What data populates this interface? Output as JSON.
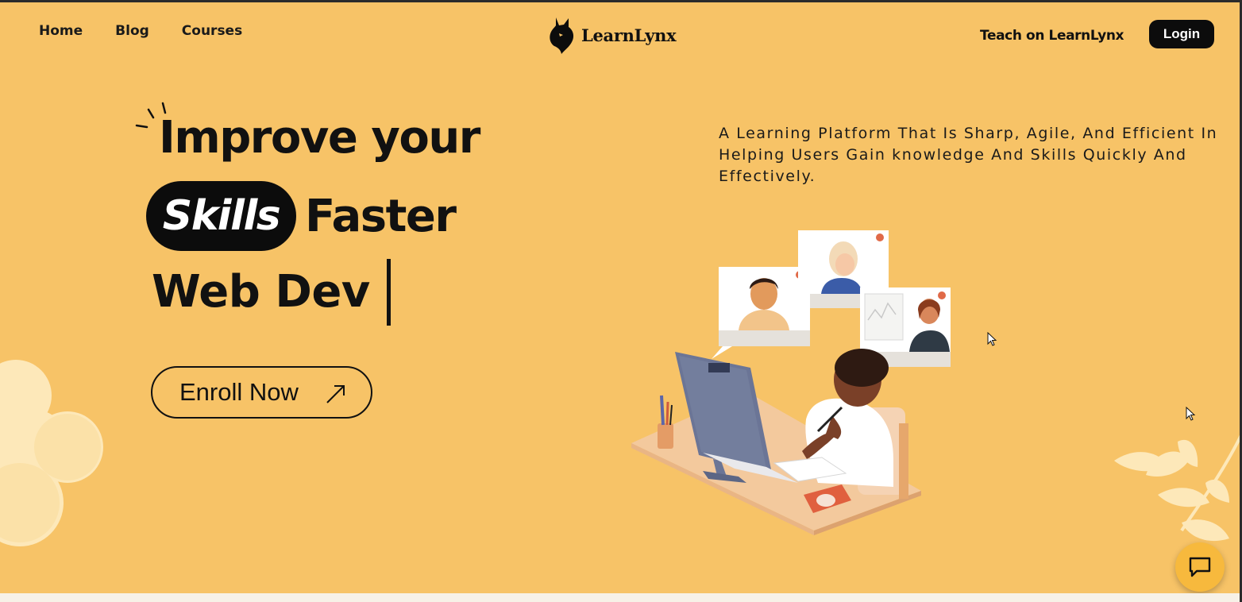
{
  "nav": {
    "links": [
      "Home",
      "Blog",
      "Courses"
    ],
    "brand": "LearnLynx",
    "teach_link": "Teach on LearnLynx",
    "login_label": "Login"
  },
  "hero": {
    "line1": "Improve your",
    "highlight": "Skills",
    "line2_rest": "Faster",
    "typed_text": "Web Dev",
    "enroll_label": "Enroll Now",
    "enroll_icon": "arrow-up-right-icon",
    "tagline": "A Learning Platform That Is Sharp, Agile, And Efficient In Helping Users Gain knowledge And Skills Quickly And Effectively."
  },
  "chat": {
    "icon": "chat-bubble-icon"
  },
  "colors": {
    "background": "#f7c367",
    "dark": "#0c0c0c",
    "accent_button": "#f7b93d",
    "cream": "#fde8b9"
  }
}
